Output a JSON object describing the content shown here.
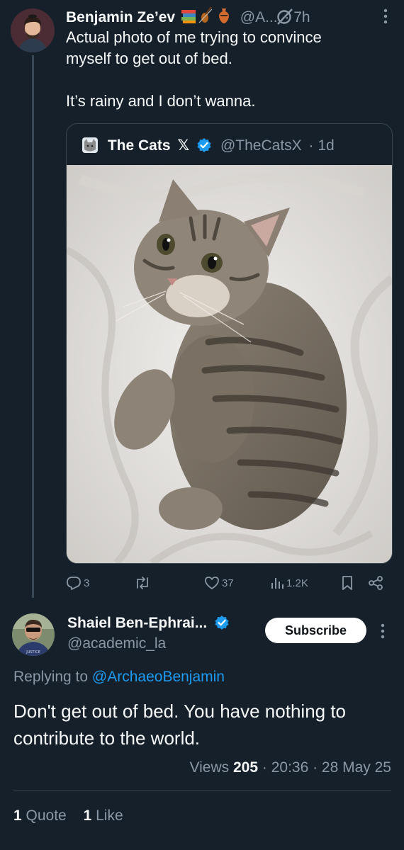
{
  "tweet": {
    "author_name": "Benjamin Ze’ev",
    "author_handle": "@A...",
    "time": "· 7h",
    "text": "Actual photo of me trying to convince\nmyself to get out of bed.\n\nIt’s rainy and I don’t wanna.",
    "quote": {
      "author_name": "The Cats",
      "x_label": "𝕏",
      "handle": "@TheCatsX",
      "time": "· 1d"
    },
    "actions": {
      "replies": "3",
      "reposts": "",
      "likes": "37",
      "views": "1.2K"
    }
  },
  "reply": {
    "author_name": "Shaiel Ben-Ephrai...",
    "author_handle": "@academic_la",
    "subscribe_label": "Subscribe",
    "replying_prefix": "Replying to ",
    "replying_to": "@ArchaeoBenjamin",
    "text": "Don't get out of bed. You have nothing to contribute to the world.",
    "views_label": "Views",
    "views_count": "205",
    "time": "· 20:36 · 28 May 25",
    "quote_count": "1",
    "quote_label": "Quote",
    "like_count": "1",
    "like_label": "Like"
  },
  "colors": {
    "background": "#15202b",
    "muted_text": "#8b98a5",
    "accent_blue": "#1d9bf0"
  }
}
